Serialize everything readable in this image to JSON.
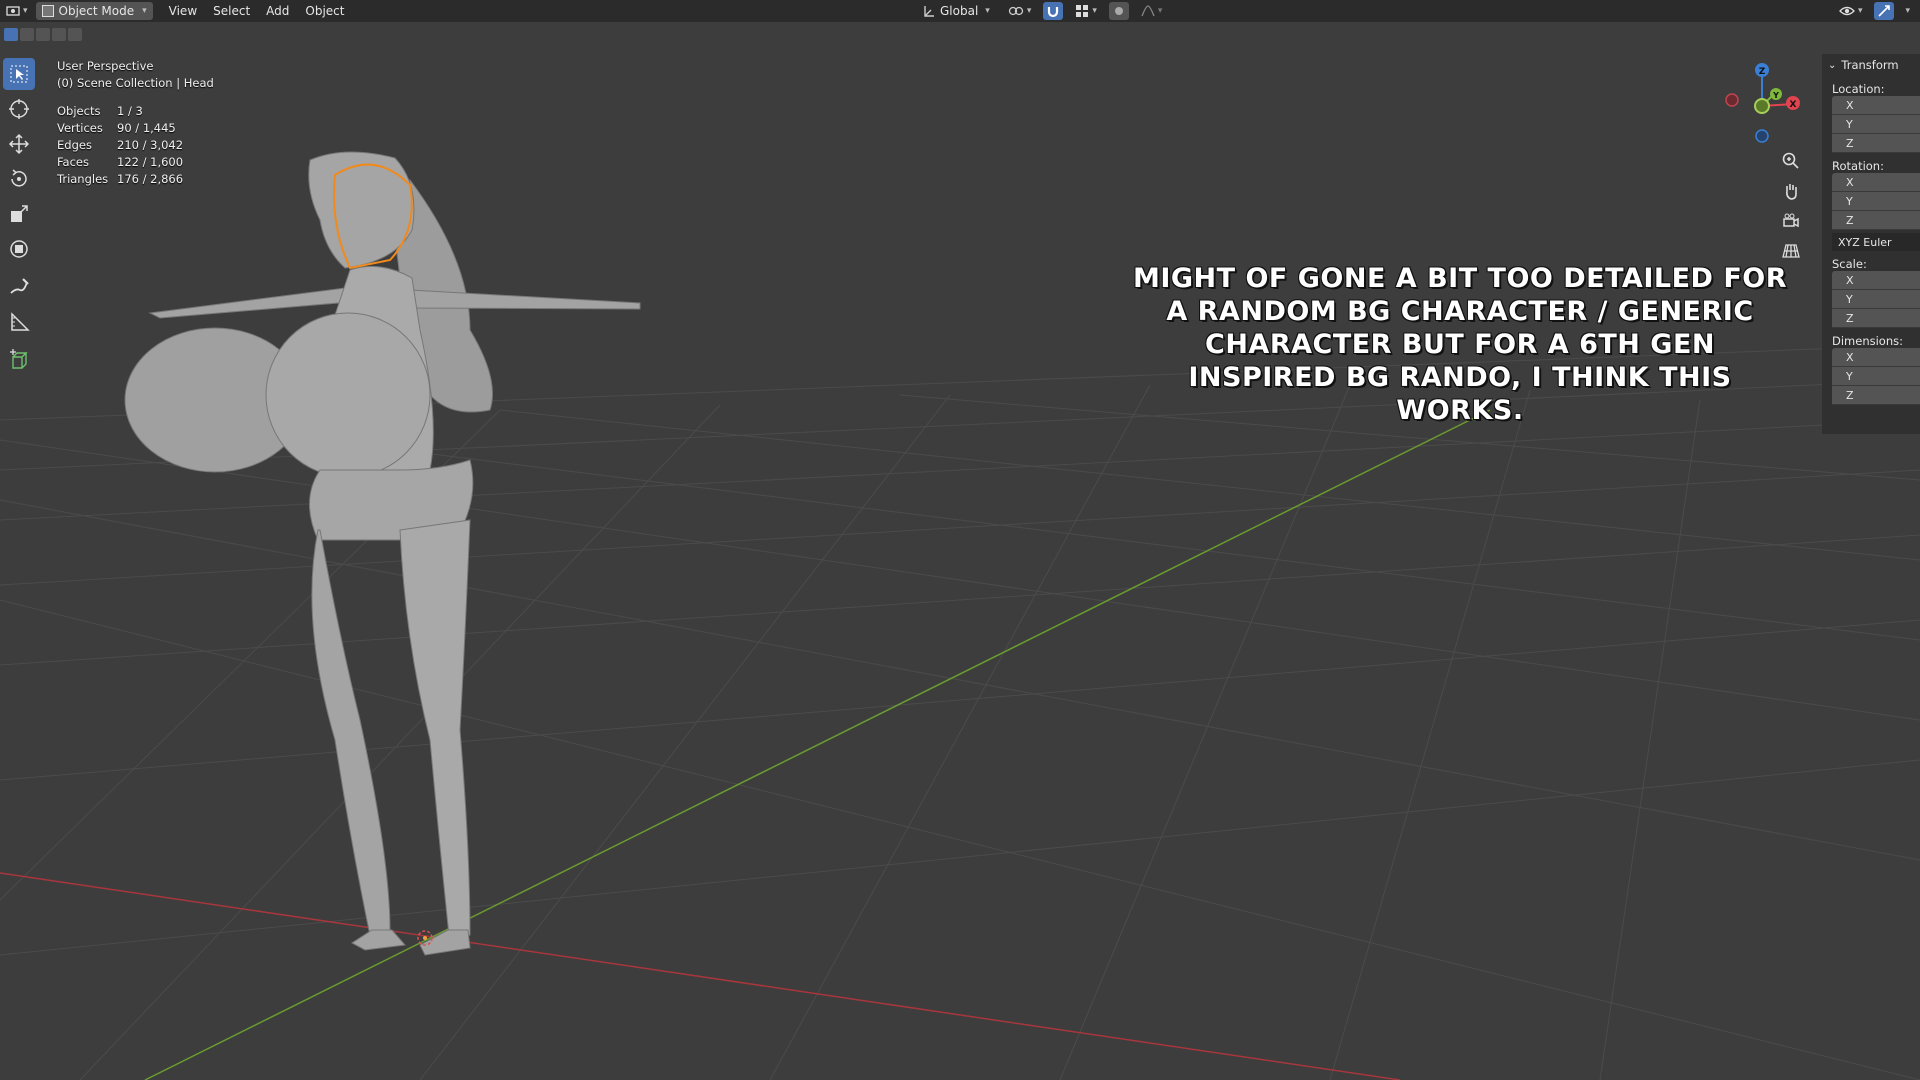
{
  "header": {
    "editor_icon": "editor-type-icon",
    "mode_label": "Object Mode",
    "menus": [
      "View",
      "Select",
      "Add",
      "Object"
    ],
    "transform_orientation": "Global",
    "colors": {
      "accent": "#4772b3",
      "header_bg": "#2b2b2b",
      "viewport_bg": "#3d3d3d"
    }
  },
  "toolbar": {
    "tools": [
      "select-box-icon",
      "cursor-icon",
      "move-icon",
      "rotate-icon",
      "scale-icon",
      "transform-icon",
      "annotate-icon",
      "measure-icon",
      "add-cube-icon"
    ]
  },
  "viewport": {
    "view_name": "User Perspective",
    "collection": "(0) Scene Collection | Head",
    "stats": [
      {
        "label": "Objects",
        "value": "1 / 3"
      },
      {
        "label": "Vertices",
        "value": "90 / 1,445"
      },
      {
        "label": "Edges",
        "value": "210 / 3,042"
      },
      {
        "label": "Faces",
        "value": "122 / 1,600"
      },
      {
        "label": "Triangles",
        "value": "176 / 2,866"
      }
    ],
    "caption": "Might of gone a bit too detailed for a random BG character / generic character but for a 6th gen inspired BG rando, I think this works.",
    "gizmo": {
      "z": "Z",
      "y": "Y",
      "x": "X"
    }
  },
  "npanel": {
    "title": "Transform",
    "location_label": "Location:",
    "rotation_label": "Rotation:",
    "rotation_mode": "XYZ Euler",
    "scale_label": "Scale:",
    "dimensions_label": "Dimensions:",
    "axes": [
      "X",
      "Y",
      "Z"
    ]
  }
}
